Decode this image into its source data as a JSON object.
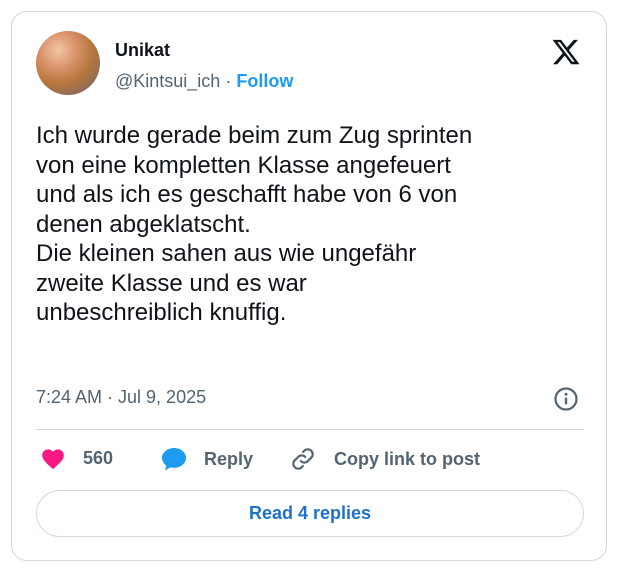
{
  "author": {
    "name": "Unikat",
    "handle": "@Kintsui_ich",
    "separator": "·",
    "follow_label": "Follow"
  },
  "tweet": {
    "text": "Ich wurde gerade beim zum Zug sprinten\nvon eine kompletten Klasse angefeuert\nund als ich es geschafft habe von 6 von\ndenen abgeklatscht.\nDie kleinen sahen aus wie ungefähr\nzweite Klasse und es war\nunbeschreiblich knuffig.",
    "timestamp": "7:24 AM · Jul 9, 2025"
  },
  "actions": {
    "like_count": "560",
    "reply_label": "Reply",
    "copy_link_label": "Copy link to post"
  },
  "read_replies_label": "Read 4 replies",
  "icons": {
    "brand": "x-logo-icon",
    "info": "info-icon",
    "like": "heart-icon",
    "reply": "speech-bubble-icon",
    "copy": "link-icon"
  },
  "colors": {
    "accent": "#1d9bf0",
    "like": "#f91880",
    "text": "#0f1419",
    "muted": "#536471",
    "border": "#cfd9de"
  }
}
